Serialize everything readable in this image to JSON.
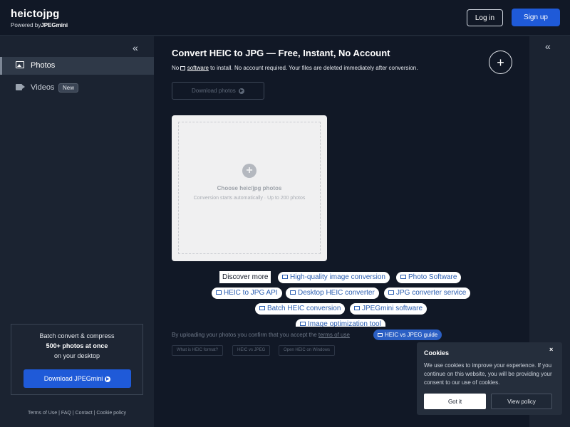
{
  "header": {
    "brand": "heictojpg",
    "powered_prefix": "Powered by",
    "powered_brand": "JPEGmini",
    "login_label": "Log in",
    "signup_label": "Sign up"
  },
  "sidebar": {
    "collapse_icon": "«",
    "items": [
      {
        "label": "Photos",
        "icon": "image-icon"
      },
      {
        "label": "Videos",
        "icon": "video-icon",
        "badge": "New"
      }
    ],
    "promo": {
      "line1": "Batch convert & compress",
      "line2": "500+ photos at once",
      "line3": "on your desktop",
      "button_label": "Download JPEGmini"
    },
    "footer": "Terms of Use | FAQ | Contact | Cookie policy"
  },
  "main": {
    "title": "Convert HEIC to JPG — Free, Instant, No Account",
    "subtitle_prefix": "No",
    "subtitle_link": "software",
    "subtitle_suffix": "to install. No account required. Your files are deleted immediately after conversion.",
    "fab_label": "+",
    "download_photos_label": "Download photos",
    "dropzone": {
      "plus": "+",
      "title": "Choose heic/jpg photos",
      "subtitle": "Conversion starts automatically · Up to 200 photos"
    },
    "discover_label": "Discover more",
    "discover_pills": [
      "High-quality image conversion",
      "Photo Software",
      "HEIC to JPG API",
      "Desktop HEIC converter",
      "JPG converter service",
      "Batch HEIC conversion",
      "JPEGmini software",
      "Image optimization tool"
    ],
    "consent_prefix": "By uploading your photos you confirm that you accept the",
    "consent_link": "terms of use",
    "guide_pill": "HEIC vs JPEG guide",
    "tags": [
      "What is HEIC format?",
      "HEIC vs JPEG",
      "Open HEIC on Windows"
    ]
  },
  "right_sidebar": {
    "collapse_icon": "«"
  },
  "cookies": {
    "title": "Cookies",
    "close": "×",
    "text": "We use cookies to improve your experience. If you continue on this website, you will be providing your consent to our use of cookies.",
    "accept_label": "Got it",
    "policy_label": "View policy"
  }
}
